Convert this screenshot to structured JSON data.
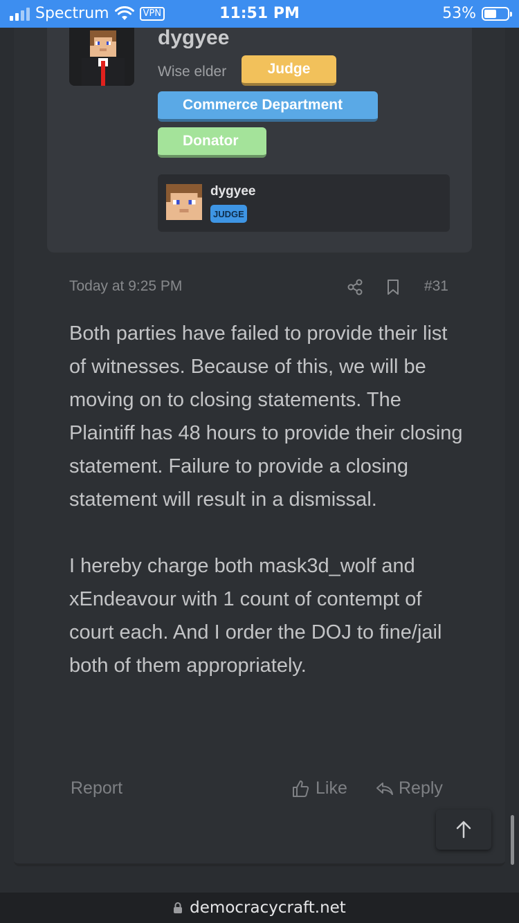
{
  "status_bar": {
    "carrier": "Spectrum",
    "vpn": "VPN",
    "time": "11:51 PM",
    "battery": "53%",
    "battery_level": 0.53,
    "icons": [
      "signal-icon",
      "wifi-icon",
      "battery-icon"
    ]
  },
  "author": {
    "name": "dygyee",
    "title": "Wise elder",
    "badges": {
      "judge": "Judge",
      "commerce": "Commerce Department",
      "donator": "Donator"
    },
    "badge_colors": {
      "judge": "#f2c15b",
      "commerce": "#5aa9e6",
      "donator": "#a4e39a"
    },
    "mini_card": {
      "name": "dygyee",
      "badge": "JUDGE"
    }
  },
  "post": {
    "date": "Today at 9:25 PM",
    "number": "#31",
    "paragraphs": [
      "Both parties have failed to provide their list of witnesses. Because of this, we will be moving on to closing statements. The Plaintiff has 48 hours to provide their closing statement. Failure to provide a closing statement will result in a dismissal.",
      "I hereby charge both mask3d_wolf and xEndeavour with 1 count of contempt of court each. And I order the DOJ to fine/jail both of them appropriately."
    ],
    "actions": {
      "report": "Report",
      "like": "Like",
      "reply": "Reply"
    }
  },
  "browser": {
    "url": "democracycraft.net"
  }
}
